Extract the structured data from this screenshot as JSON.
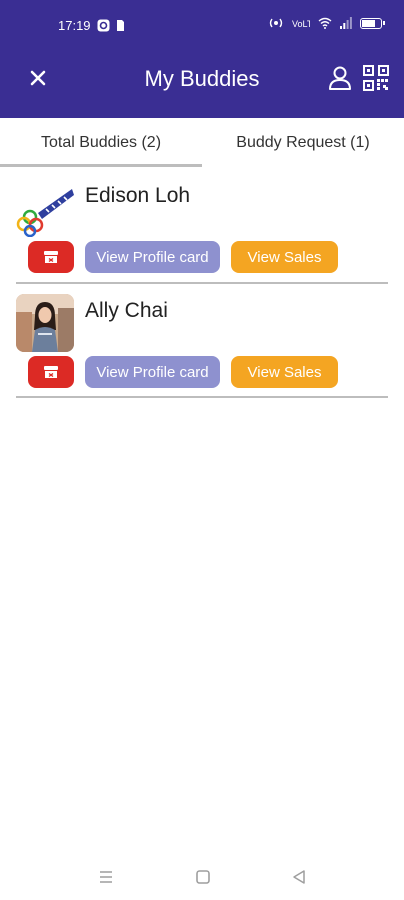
{
  "status_bar": {
    "time": "17:19",
    "battery_level": 0.65,
    "icons": [
      "focus-icon",
      "sim-icon",
      "hotspot-icon",
      "volte-icon",
      "wifi-icon",
      "signal-icon",
      "battery-icon"
    ]
  },
  "app_bar": {
    "title": "My Buddies",
    "close_icon": "close-icon",
    "profile_icon": "person-icon",
    "qr_icon": "qr-code-icon",
    "background": "#3a2e93"
  },
  "tabs": [
    {
      "label": "Total Buddies (2)",
      "selected": true
    },
    {
      "label": "Buddy Request (1)",
      "selected": false
    }
  ],
  "buddies": [
    {
      "name": "Edison Loh",
      "delete_icon": "archive-delete-icon",
      "profile_label": "View Profile card",
      "sales_label": "View Sales"
    },
    {
      "name": "Ally Chai",
      "delete_icon": "archive-delete-icon",
      "profile_label": "View Profile card",
      "sales_label": "View Sales"
    }
  ],
  "colors": {
    "delete": "#dc2a25",
    "profile": "#8e91cf",
    "sales": "#f4a522"
  },
  "nav_bar": {
    "icons": [
      "menu-icon",
      "home-icon",
      "back-icon"
    ]
  }
}
